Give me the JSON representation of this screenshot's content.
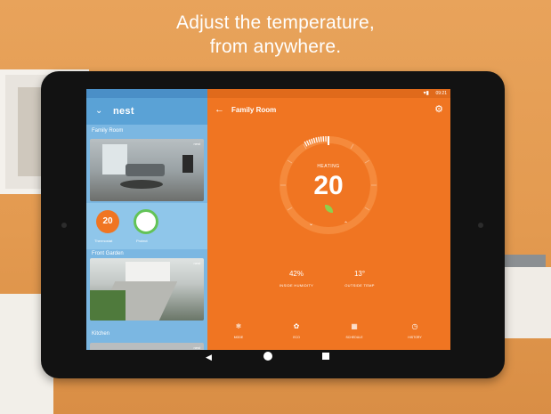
{
  "headline": {
    "line1": "Adjust the temperature,",
    "line2": "from anywhere."
  },
  "left_panel": {
    "brand": "nest",
    "rooms": [
      {
        "name": "Family Room",
        "badge": "nest"
      },
      {
        "name": "Front Garden",
        "badge": "nest"
      },
      {
        "name": "Kitchen",
        "badge": "nest"
      }
    ],
    "devices": {
      "thermostat_value": "20",
      "thermostat_label": "Thermostat",
      "protect_label": "Protect"
    }
  },
  "header": {
    "room_title": "Family Room",
    "status_time": "09:21"
  },
  "thermostat": {
    "mode": "HEATING",
    "target": "20",
    "down": "⌄",
    "up": "⌃"
  },
  "stats": {
    "humidity_value": "42%",
    "humidity_label": "INSIDE HUMIDITY",
    "outdoor_value": "13°",
    "outdoor_label": "OUTSIDE TEMP"
  },
  "bottom_nav": [
    {
      "label": "MODE",
      "icon": "mode-icon"
    },
    {
      "label": "ECO",
      "icon": "leaf-icon"
    },
    {
      "label": "SCHEDULE",
      "icon": "schedule-icon"
    },
    {
      "label": "HISTORY",
      "icon": "history-icon"
    }
  ],
  "colors": {
    "accent": "#f07522",
    "left_panel": "#7bb7e2",
    "leaf": "#8dd04d",
    "protect_ring": "#63c357"
  }
}
